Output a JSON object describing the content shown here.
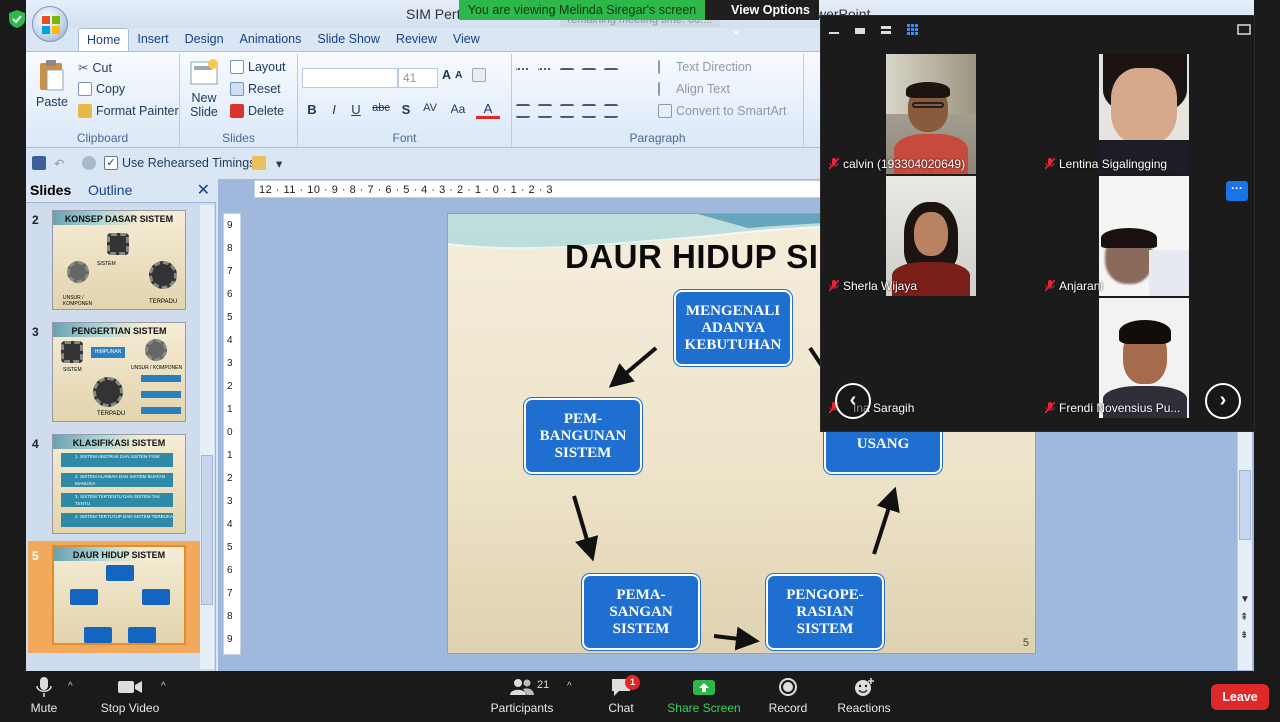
{
  "banner": {
    "viewing": "You are viewing Melinda Siregar's screen",
    "view_options": "View Options",
    "remaining": "remaining meeting time: 00:..."
  },
  "ppt": {
    "doc_title": "SIM Perte",
    "title_tail": "werPoint",
    "tabs": [
      "Home",
      "Insert",
      "Design",
      "Animations",
      "Slide Show",
      "Review",
      "View"
    ],
    "clipboard": {
      "paste": "Paste",
      "cut": "Cut",
      "copy": "Copy",
      "format_painter": "Format Painter",
      "group": "Clipboard"
    },
    "slides": {
      "new_slide": "New Slide",
      "layout": "Layout",
      "reset": "Reset",
      "delete": "Delete",
      "group": "Slides"
    },
    "font": {
      "size": "41",
      "bold": "B",
      "italic": "I",
      "underline": "U",
      "strike": "abc",
      "shadow": "S",
      "group": "Font"
    },
    "paragraph": {
      "text_direction": "Text Direction",
      "align_text": "Align Text",
      "smartart": "Convert to SmartArt",
      "group": "Paragraph"
    },
    "qat": {
      "rehearsed": "Use Rehearsed Timings"
    },
    "pane_tabs": {
      "slides": "Slides",
      "outline": "Outline"
    },
    "hruler": "12 · 11 · 10 · 9 · 8 · 7 · 6 · 5 · 4 · 3 · 2 · 1 · 0 · 1 · 2 · 3",
    "vruler": [
      "9",
      "8",
      "7",
      "6",
      "5",
      "4",
      "3",
      "2",
      "1",
      "0",
      "1",
      "2",
      "3",
      "4",
      "5",
      "6",
      "7",
      "8",
      "9"
    ]
  },
  "thumbnails": [
    {
      "num": "2",
      "title": "KONSEP DASAR SISTEM",
      "labels": [
        "SISTEM",
        "UNSUR / KOMPONEN",
        "TERPADU"
      ]
    },
    {
      "num": "3",
      "title": "PENGERTIAN SISTEM",
      "labels": [
        "SISTEM",
        "HIMPUNAN",
        "UNSUR / KOMPONEN",
        "TERPADU"
      ]
    },
    {
      "num": "4",
      "title": "KLASIFIKASI SISTEM",
      "labels": [
        "1. SISTEM ABSTRAK DAN SISTEM FISIK",
        "2. SISTEM ALAMIAH DAN SISTEM BUATAN MANUSIA",
        "3. SISTEM TERTENTU DAN SISTEM TAK TENTU",
        "4. SISTEM TERTUTUP DAN SISTEM TERBUKA"
      ]
    },
    {
      "num": "5",
      "title": "DAUR HIDUP SISTEM",
      "labels": []
    }
  ],
  "slide": {
    "title": "DAUR HIDUP SI",
    "boxes": {
      "mengenali": "MENGENALI ADANYA KEBUTUHAN",
      "pembangunan": "PEM-BANGUNAN SISTEM",
      "pemasangan": "PEMA-SANGAN SISTEM",
      "pengoperasian": "PENGOPE-RASIAN SISTEM",
      "usang": "MENJADI USANG"
    },
    "number": "5"
  },
  "participants": [
    {
      "name": "calvin (193304020649)",
      "muted": true
    },
    {
      "name": "Lentina Sigalingging",
      "muted": true
    },
    {
      "name": "Sherla Wijaya",
      "muted": true
    },
    {
      "name": "Anjarani",
      "muted": true
    },
    {
      "name": "Ina Saragih",
      "muted": true
    },
    {
      "name": "Frendi Novensius Pu...",
      "muted": true
    }
  ],
  "toolbar": {
    "mute": "Mute",
    "stop_video": "Stop Video",
    "participants": "Participants",
    "participants_count": "21",
    "chat": "Chat",
    "chat_badge": "1",
    "share_screen": "Share Screen",
    "record": "Record",
    "reactions": "Reactions",
    "leave": "Leave"
  },
  "colors": {
    "share_green": "#2db84c",
    "leave_red": "#e02828",
    "slide_box_blue": "#1f6fd1",
    "ribbon_blue": "#dbe6f4"
  }
}
